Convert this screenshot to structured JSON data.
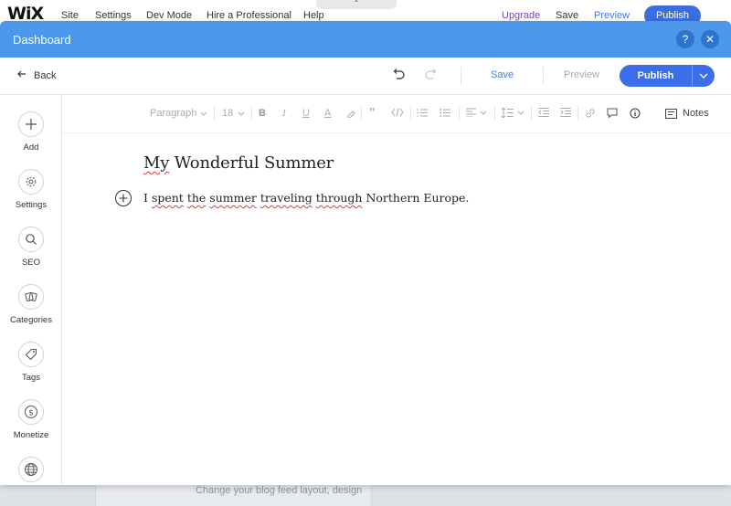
{
  "background": {
    "logo": "WiX",
    "menu": [
      "Site",
      "Settings",
      "Dev Mode",
      "Hire a Professional",
      "Help"
    ],
    "upgrade": "Upgrade",
    "save": "Save",
    "preview": "Preview",
    "publish": "Publish",
    "bottom_text": "Change your blog feed layout, design"
  },
  "modal": {
    "title": "Dashboard",
    "help": "?",
    "close": "✕"
  },
  "actionbar": {
    "back": "Back",
    "save": "Save",
    "preview": "Preview",
    "publish": "Publish"
  },
  "sidebar": {
    "items": [
      {
        "label": "Add",
        "icon": "plus-icon"
      },
      {
        "label": "Settings",
        "icon": "gear-icon"
      },
      {
        "label": "SEO",
        "icon": "search-icon"
      },
      {
        "label": "Categories",
        "icon": "categories-icon"
      },
      {
        "label": "Tags",
        "icon": "tag-icon"
      },
      {
        "label": "Monetize",
        "icon": "dollar-icon"
      },
      {
        "label": "",
        "icon": "globe-icon"
      }
    ]
  },
  "toolbar": {
    "paragraph": "Paragraph",
    "font_size": "18",
    "bold": "B",
    "italic": "I",
    "underline": "U",
    "text_color": "A",
    "notes": "Notes"
  },
  "post": {
    "title": "My Wonderful Summer",
    "body_words": [
      "I",
      "spent",
      "the",
      "summer",
      "traveling",
      "through",
      "Northern Europe."
    ]
  },
  "colors": {
    "header": "#4b97ea",
    "publish": "#3b6ee8",
    "link": "#3b7ce8",
    "spellcheck": "#e0393e"
  }
}
